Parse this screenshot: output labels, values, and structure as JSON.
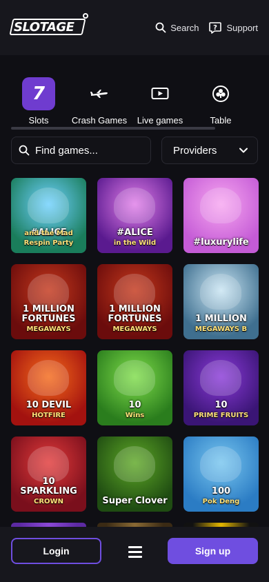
{
  "header": {
    "logo_text": "SLOTAGE",
    "search_label": "Search",
    "support_label": "Support"
  },
  "categories": [
    {
      "label": "Slots",
      "icon": "seven-icon",
      "active": true
    },
    {
      "label": "Crash Games",
      "icon": "airplane-icon",
      "active": false
    },
    {
      "label": "Live games",
      "icon": "play-icon",
      "active": false
    },
    {
      "label": "Table",
      "icon": "club-icon",
      "active": false
    }
  ],
  "search": {
    "placeholder": "Find games..."
  },
  "providers": {
    "label": "Providers"
  },
  "games": [
    {
      "title": "#ALICE",
      "subtitle": "and the Mad Respin Party",
      "colors": [
        "#1a7d5b",
        "#6fd1ff"
      ]
    },
    {
      "title": "#ALICE",
      "subtitle": "in the Wild",
      "colors": [
        "#5a1a8f",
        "#e07de8"
      ]
    },
    {
      "title": "#luxurylife",
      "subtitle": "",
      "colors": [
        "#c45bd6",
        "#f7a6f0"
      ]
    },
    {
      "title": "1 MILLION FORTUNES",
      "subtitle": "MEGAWAYS",
      "colors": [
        "#6b0c0c",
        "#c4381c"
      ]
    },
    {
      "title": "1 MILLION FORTUNES",
      "subtitle": "MEGAWAYS",
      "colors": [
        "#6b0c0c",
        "#c4381c"
      ]
    },
    {
      "title": "1 MILLION",
      "subtitle": "MEGAWAYS B",
      "colors": [
        "#3f6f8f",
        "#c9e5f3"
      ]
    },
    {
      "title": "10 DEVIL",
      "subtitle": "HOTFIRE",
      "colors": [
        "#a3120f",
        "#f46a1a"
      ]
    },
    {
      "title": "10",
      "subtitle": "Wins",
      "colors": [
        "#2a7d1d",
        "#7fdd4a"
      ]
    },
    {
      "title": "10",
      "subtitle": "PRIME FRUITS",
      "colors": [
        "#3a1575",
        "#8a3ad8"
      ]
    },
    {
      "title": "10 SPARKLING",
      "subtitle": "CROWN",
      "colors": [
        "#7a0f1c",
        "#e23a3a"
      ]
    },
    {
      "title": "Super Clover",
      "subtitle": "",
      "colors": [
        "#1f4c12",
        "#5ea826"
      ]
    },
    {
      "title": "100",
      "subtitle": "Pok Deng",
      "colors": [
        "#2b7cc4",
        "#78c6ef"
      ]
    },
    {
      "title": "",
      "subtitle": "",
      "colors": [
        "#5d2aa3",
        "#8b49d6"
      ]
    },
    {
      "title": "",
      "subtitle": "",
      "colors": [
        "#3a2a14",
        "#8a6a34"
      ]
    },
    {
      "title": "",
      "subtitle": "",
      "colors": [
        "#111111",
        "#e6b800"
      ]
    }
  ],
  "bottom": {
    "login_label": "Login",
    "signup_label": "Sign up"
  },
  "colors": {
    "accent": "#6f4ee0",
    "active_category": "#6f3ccf",
    "background": "#0f0f14",
    "bar": "#17171d"
  }
}
